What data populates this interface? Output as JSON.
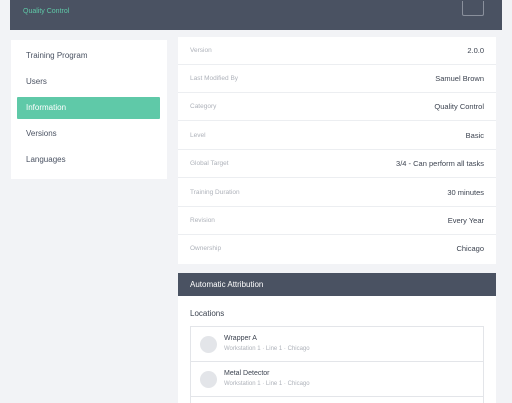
{
  "header": {
    "breadcrumb": "Quality Control"
  },
  "sidebar": {
    "items": [
      {
        "label": "Training Program"
      },
      {
        "label": "Users"
      },
      {
        "label": "Information"
      },
      {
        "label": "Versions"
      },
      {
        "label": "Languages"
      }
    ],
    "active": "Information"
  },
  "info": {
    "rows": [
      {
        "label": "Version",
        "value": "2.0.0"
      },
      {
        "label": "Last Modified By",
        "value": "Samuel Brown"
      },
      {
        "label": "Category",
        "value": "Quality Control"
      },
      {
        "label": "Level",
        "value": "Basic"
      },
      {
        "label": "Global Target",
        "value": "3/4 - Can perform all tasks"
      },
      {
        "label": "Training Duration",
        "value": "30 minutes"
      },
      {
        "label": "Revision",
        "value": "Every Year"
      },
      {
        "label": "Ownership",
        "value": "Chicago"
      }
    ]
  },
  "attribution": {
    "title": "Automatic Attribution",
    "locations_title": "Locations",
    "locations": [
      {
        "name": "Wrapper A",
        "path": "Workstation 1 · Line 1 · Chicago"
      },
      {
        "name": "Metal Detector",
        "path": "Workstation 1 · Line 1 · Chicago"
      }
    ]
  },
  "colors": {
    "accent": "#5fc9a8",
    "header_bg": "#4a5262",
    "page_bg": "#f2f3f6"
  }
}
